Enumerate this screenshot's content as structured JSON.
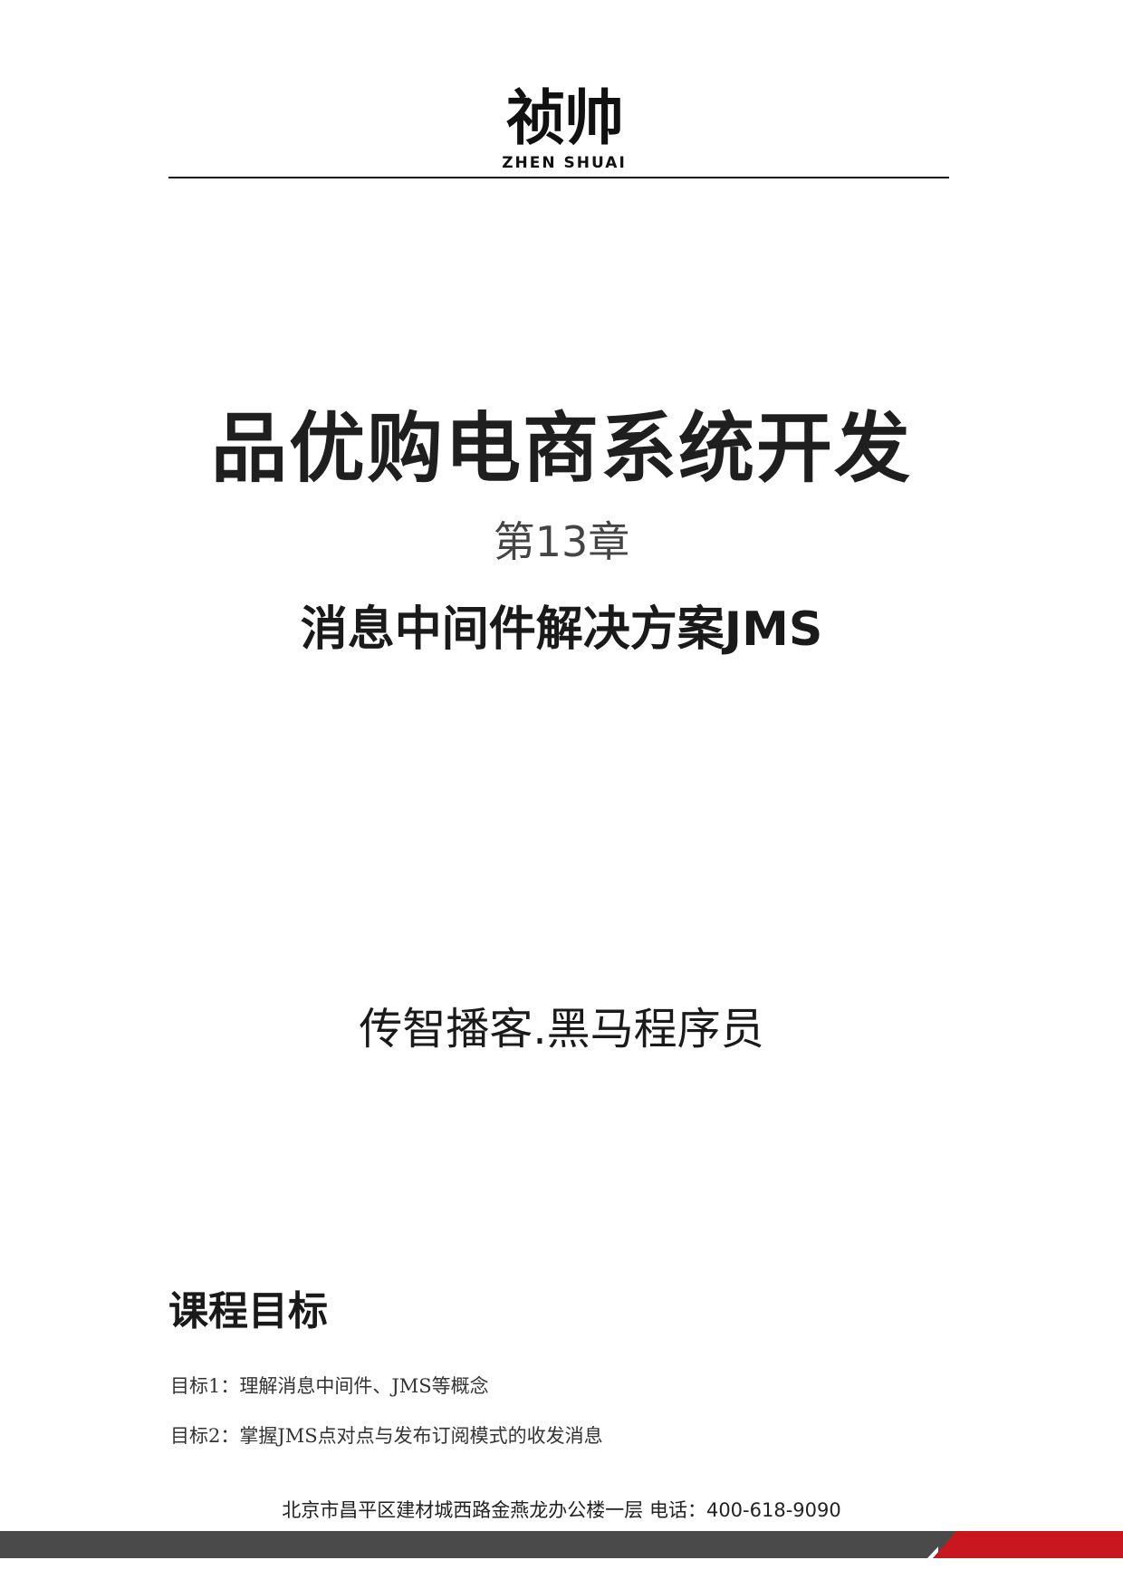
{
  "header": {
    "logo_cn": "祯帅",
    "logo_en": "ZHEN SHUAI"
  },
  "cover": {
    "title": "品优购电商系统开发",
    "chapter": "第13章",
    "subtitle": "消息中间件解决方案JMS",
    "publisher": "传智播客.黑马程序员"
  },
  "goals": {
    "heading": "课程目标",
    "items": [
      "目标1：理解消息中间件、JMS等概念",
      "目标2：掌握JMS点对点与发布订阅模式的收发消息"
    ]
  },
  "footer": {
    "address": "北京市昌平区建材城西路金燕龙办公楼一层   电话：400-618-9090",
    "colors": {
      "bar": "#4a4a4a",
      "accent": "#c8171f"
    }
  }
}
